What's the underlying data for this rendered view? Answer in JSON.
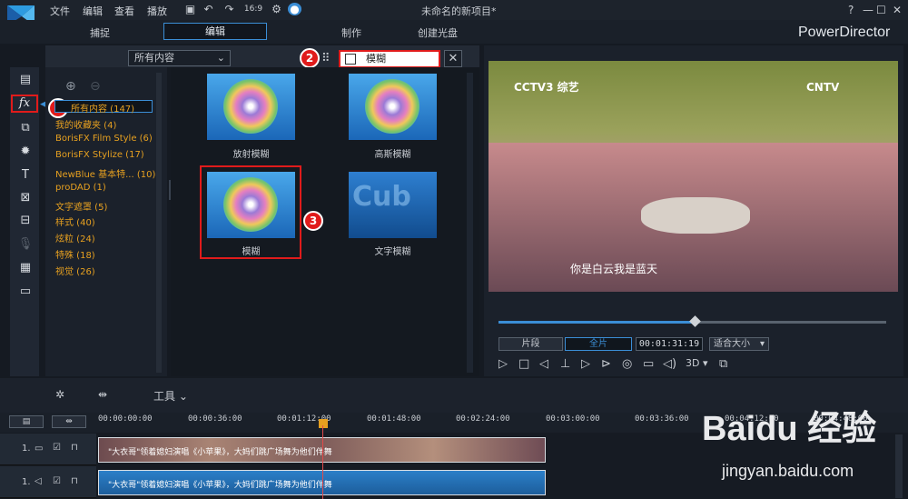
{
  "menu": {
    "file": "文件",
    "edit": "编辑",
    "view": "查看",
    "play": "播放",
    "zoom": "16:9"
  },
  "window": {
    "title": "未命名的新项目*",
    "help": "?",
    "minimize": "—",
    "maximize": "☐",
    "close": "✕"
  },
  "tabs": {
    "capture": "捕捉",
    "edit": "编辑",
    "produce": "制作",
    "disc": "创建光盘"
  },
  "brand": "PowerDirector",
  "library": {
    "dropdown": "所有内容",
    "search_value": "模糊",
    "categories": [
      "所有内容 (147)",
      "我的收藏夹 (4)",
      "BorisFX Film Style (6)",
      "BorisFX Stylize (17)",
      "NewBlue 基本特... (10)",
      "proDAD (1)",
      "文字遮罩 (5)",
      "样式 (40)",
      "炫粒 (24)",
      "特殊 (18)",
      "视觉 (26)"
    ]
  },
  "effects": [
    "放射模糊",
    "高斯模糊",
    "模糊",
    "文字模糊"
  ],
  "badges": {
    "b1": "1",
    "b2": "2",
    "b3": "3"
  },
  "preview": {
    "subtitle": "你是白云我是蓝天",
    "logo1": "CCTV3 综艺",
    "logo2": "CNTV",
    "clip_btn": "片段",
    "movie_btn": "全片",
    "timecode": "00:01:31:19",
    "fit": "适合大小",
    "mode3d": "3D"
  },
  "timeline": {
    "tools_label": "工具",
    "ticks": [
      "00:00:00:00",
      "00:00:36:00",
      "00:01:12:00",
      "00:01:48:00",
      "00:02:24:00",
      "00:03:00:00",
      "00:03:36:00",
      "00:04:12:00",
      "00:04:48:00"
    ],
    "track1": "1.",
    "track2": "1.",
    "clip_text": "\"大衣哥\"领着媳妇演唱《小苹果》，大妈们跳广场舞为他们伴舞"
  },
  "watermark": {
    "main": "Baidu 经验",
    "sub": "jingyan.baidu.com"
  }
}
